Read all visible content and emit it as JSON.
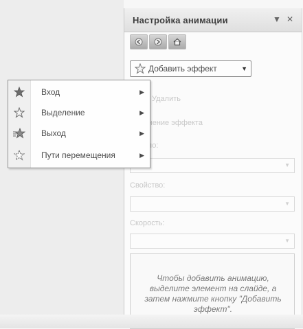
{
  "panel": {
    "title": "Настройка анимации",
    "dropdown_glyph": "▼",
    "close_glyph": "✕",
    "add_effect_label": "Добавить эффект",
    "remove_label": "Удалить",
    "change_effect_label": "Изменение эффекта",
    "start_label": "Начало:",
    "property_label": "Свойство:",
    "speed_label": "Скорость:",
    "hint": "Чтобы добавить анимацию, выделите элемент на слайде, а затем нажмите кнопку \"Добавить эффект\"."
  },
  "menu": {
    "items": [
      {
        "label": "Вход",
        "icon": "star-entrance-icon"
      },
      {
        "label": "Выделение",
        "icon": "star-emphasis-icon"
      },
      {
        "label": "Выход",
        "icon": "star-exit-icon"
      },
      {
        "label": "Пути перемещения",
        "icon": "motion-path-star-icon"
      }
    ],
    "submenu_glyph": "▶"
  }
}
